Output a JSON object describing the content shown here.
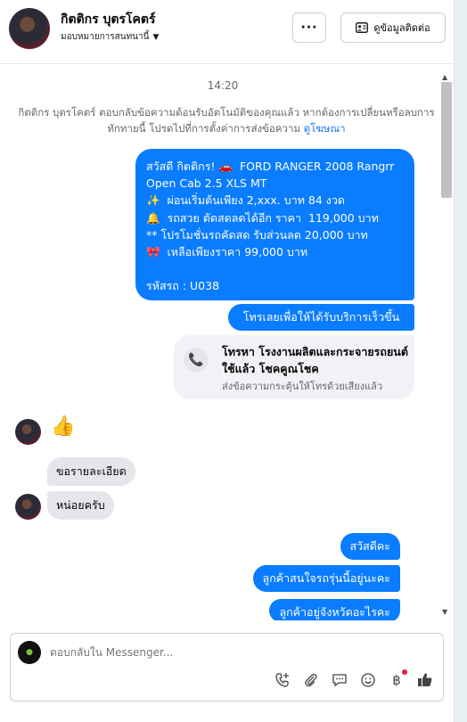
{
  "header": {
    "name": "กิตติกร บุตรโคตร์",
    "assign_label": "มอบหมายการสนทนานี้",
    "more_label": "···",
    "contact_button": "ดูข้อมูลติดต่อ"
  },
  "conversation": {
    "timestamp": "14:20",
    "notice_text": "กิตติกร บุตรโคตร์ ตอบกลับข้อความต้อนรับอัตโนมัติของคุณแล้ว หากต้องการเปลี่ยนหรือลบการทักทายนี้ โปรดไปที่การตั้งค่าการส่งข้อความ",
    "notice_link": "ดูโฆษณา",
    "ad_message": "สวัสดี กิตติกร! 🚗  FORD RANGER 2008 Rangrr Open Cab 2.5 XLS MT\n✨  ผ่อนเริ่มต้นเพียง 2,xxx. บาท 84 งวด\n🔔  รถสวย ตัดสดลดได้อีก ราคา  119,000 บาท\n** โปรโมชั่นรถคัดสด รับส่วนลด 20,000 บาท\n🎀  เหลือเพียงราคา 99,000 บาท\n\nรหัสรถ : U038",
    "call_message": "โทรเลยเพื่อให้ได้รับบริการเร็วขึ้น",
    "call_card": {
      "title": "โทรหา โรงงานผลิตและกระจายรถยนต์ใช้แล้ว โชคคูณโชค",
      "subtitle": "ส่งข้อความกระตุ้นให้โทรด้วยเสียงแล้ว"
    },
    "incoming": [
      "ขอรายละเอียด",
      "หน่อยครับ"
    ],
    "outgoing": [
      "สวัสดีคะ",
      "ลูกค้าสนใจรถรุ่นนี้อยู่นะคะ",
      "ลูกค้าอยู่จังหวัดอะไรคะ"
    ]
  },
  "composer": {
    "placeholder": "ตอบกลับใน Messenger..."
  },
  "colors": {
    "outgoing_bubble": "#0a7cff",
    "incoming_bubble": "#e4e6eb",
    "link": "#1877f2"
  }
}
